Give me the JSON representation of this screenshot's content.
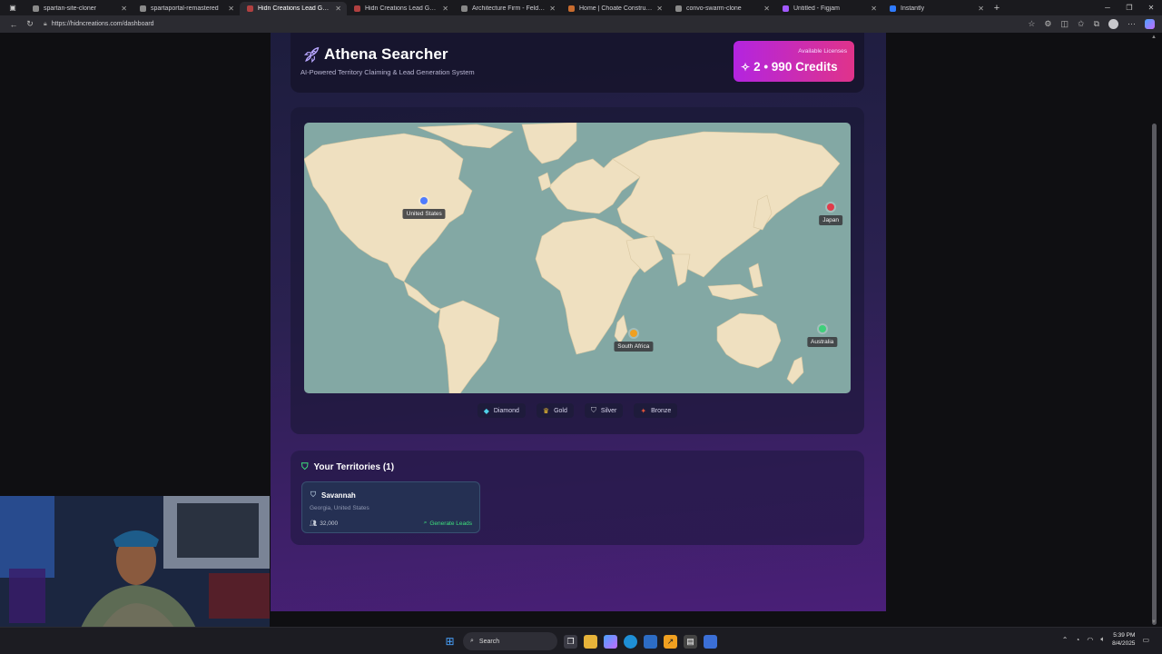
{
  "browser": {
    "tabs": [
      {
        "title": "spartan-site-cloner",
        "favicon_color": "#8a8a8a",
        "active": false
      },
      {
        "title": "spartaportal-remastered",
        "favicon_color": "#8a8a8a",
        "active": false
      },
      {
        "title": "Hidn Creations Lead Generator -",
        "favicon_color": "#b04040",
        "active": true
      },
      {
        "title": "Hidn Creations Lead Generator -",
        "favicon_color": "#b04040",
        "active": false
      },
      {
        "title": "Architecture Firm - Felder & Asso",
        "favicon_color": "#888888",
        "active": false
      },
      {
        "title": "Home | Choate Construction",
        "favicon_color": "#c76b2e",
        "active": false
      },
      {
        "title": "convo-swarm-clone",
        "favicon_color": "#8a8a8a",
        "active": false
      },
      {
        "title": "Untitled - Figjam",
        "favicon_color": "#a259ff",
        "active": false
      },
      {
        "title": "Instantly",
        "favicon_color": "#2f7bff",
        "active": false
      }
    ],
    "url": "https://hidncreations.com/dashboard"
  },
  "app": {
    "title": "Athena Searcher",
    "subtitle": "AI-Powered Territory Claiming & Lead Generation System",
    "credits": {
      "caption": "Available Licenses",
      "value": "2 • 990 Credits"
    }
  },
  "map": {
    "markers": [
      {
        "label": "United States",
        "color": "#4f7cff",
        "lon": -98,
        "lat": 39
      },
      {
        "label": "Japan",
        "color": "#e03b4a",
        "lon": 139,
        "lat": 36
      },
      {
        "label": "South Africa",
        "color": "#f0a020",
        "lon": 24,
        "lat": -27
      },
      {
        "label": "Australia",
        "color": "#3ed07a",
        "lon": 134,
        "lat": -25
      }
    ]
  },
  "legend": [
    {
      "label": "Diamond",
      "icon": "diamond-icon",
      "color": "#4fd1e8"
    },
    {
      "label": "Gold",
      "icon": "trophy-icon",
      "color": "#f2c230"
    },
    {
      "label": "Silver",
      "icon": "shield-icon",
      "color": "#c9c9d6"
    },
    {
      "label": "Bronze",
      "icon": "star-icon",
      "color": "#e0533a"
    }
  ],
  "territories": {
    "heading": "Your Territories (1)",
    "items": [
      {
        "name": "Savannah",
        "location": "Georgia, United States",
        "population": "32,000",
        "action": "Generate Leads"
      }
    ]
  },
  "taskbar": {
    "search_placeholder": "Search",
    "time": "5:39 PM",
    "date": "8/4/2025"
  }
}
